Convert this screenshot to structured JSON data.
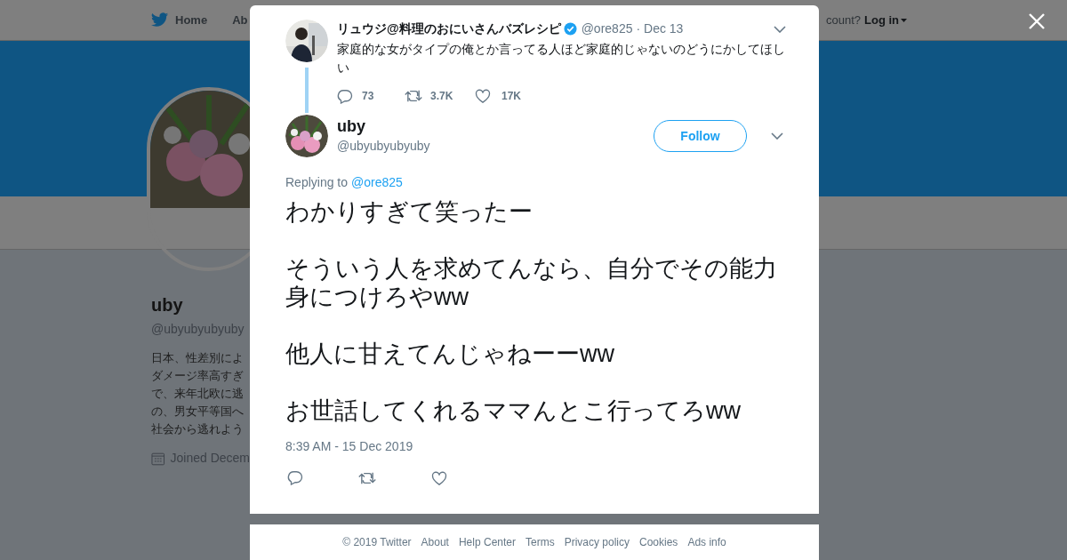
{
  "background_page": {
    "nav": {
      "items": [
        "Home",
        "Ab"
      ],
      "account_prompt": "count?",
      "login": "Log in"
    },
    "profile": {
      "name": "uby",
      "handle": "@ubyubyubyuby",
      "bio_lines": [
        "日本、性差別によ",
        "ダメージ率高すぎ",
        "で、来年北欧に逃",
        "の、男女平等国へ",
        "社会から逃れよう"
      ],
      "joined": "Joined Decem"
    }
  },
  "modal": {
    "parent_tweet": {
      "name": "リュウジ@料理のおにいさんバズレシピ",
      "verified": true,
      "handle": "@ore825",
      "date": "· Dec 13",
      "text": "家庭的な女がタイプの俺とか言ってる人ほど家庭的じゃないのどうにかしてほしい",
      "replies": "73",
      "retweets": "3.7K",
      "likes": "17K"
    },
    "tweet": {
      "name": "uby",
      "handle": "@ubyubyubyuby",
      "follow": "Follow",
      "replying_label": "Replying to",
      "replying_to": "@ore825",
      "paragraphs": [
        "わかりすぎて笑ったー",
        "そういう人を求めてんなら、自分でその能力身につけろやww",
        "他人に甘えてんじゃねーーww",
        "お世話してくれるママんとこ行ってろww"
      ],
      "timestamp": "8:39 AM - 15 Dec 2019"
    }
  },
  "footer": [
    "© 2019 Twitter",
    "About",
    "Help Center",
    "Terms",
    "Privacy policy",
    "Cookies",
    "Ads info"
  ]
}
